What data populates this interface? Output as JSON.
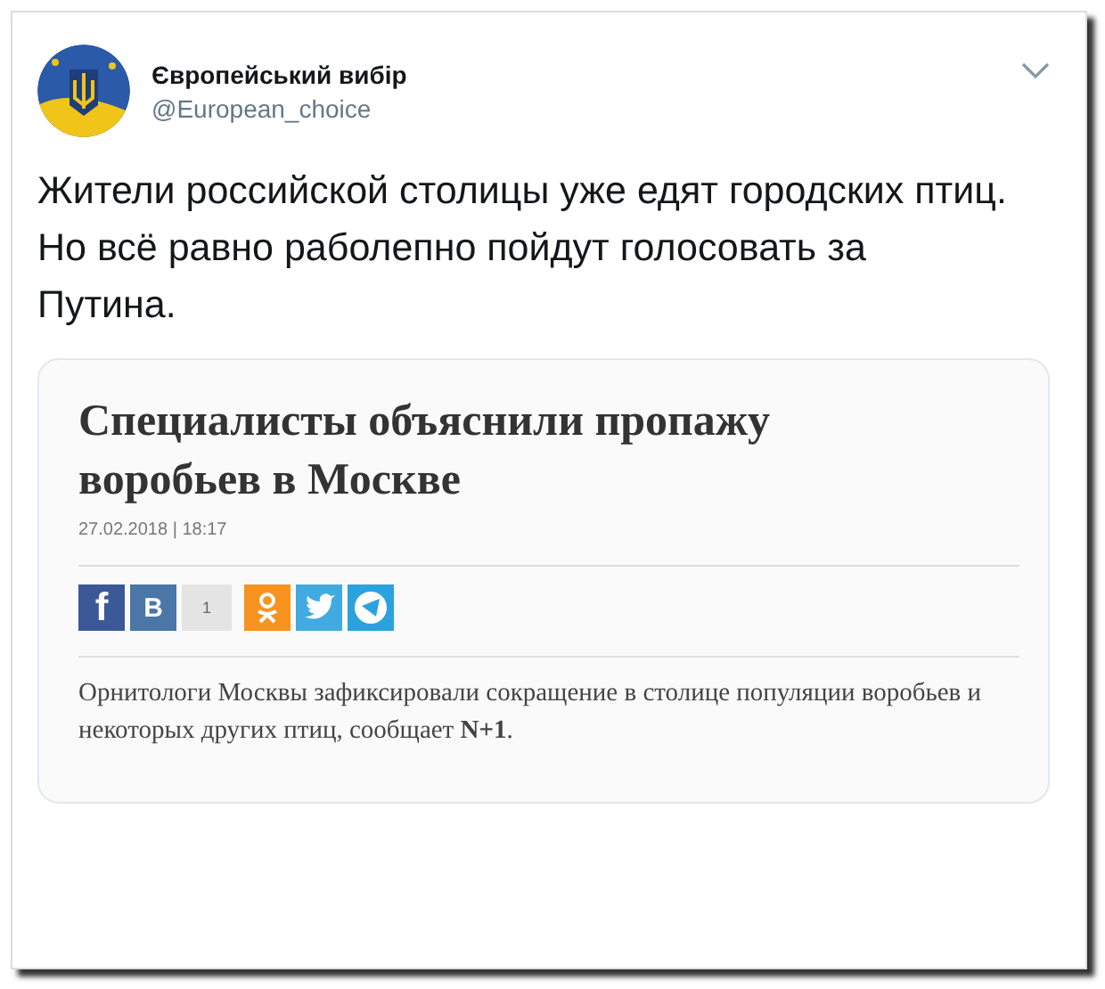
{
  "tweet": {
    "author": {
      "name": "Європейський вибір",
      "handle": "@European_choice"
    },
    "text": [
      "Жители российской столицы уже едят городских птиц.",
      "Но всё равно раболепно пойдут голосовать за Путина."
    ],
    "quote": {
      "title": "Специалисты объяснили пропажу воробьев в Москве",
      "date": "27.02.2018 | 18:17",
      "share": [
        {
          "kind": "facebook",
          "label": "f"
        },
        {
          "kind": "vk",
          "label": "В"
        },
        {
          "kind": "count",
          "label": "1"
        },
        {
          "kind": "ok"
        },
        {
          "kind": "twitter"
        },
        {
          "kind": "telegram"
        }
      ],
      "body": "Орнитологи Москвы зафиксировали сокращение в столице популяции воробьев и некоторых других птиц, сообщает **N+1**."
    }
  }
}
